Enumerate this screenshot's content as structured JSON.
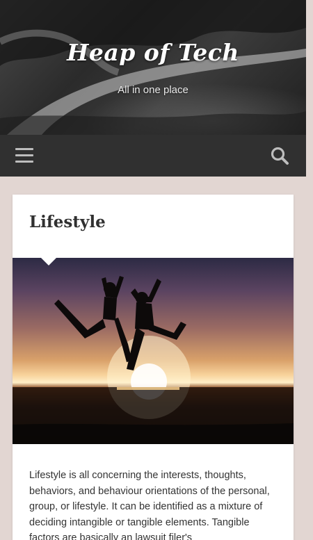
{
  "header": {
    "site_title": "Heap of Tech",
    "site_description": "All in one place"
  },
  "nav": {
    "menu_icon": "hamburger-menu-icon",
    "search_icon": "search-icon"
  },
  "post": {
    "title": "Lifestyle",
    "image_alt": "silhouettes jumping at sunset",
    "excerpt": "Lifestyle is all concerning the interests, thoughts, behaviors, and behaviour orientations of the personal, group, or lifestyle. It can be identified as a mixture of deciding intangible or tangible elements. Tangible factors are basically an lawsuit filer's"
  },
  "colors": {
    "page_bg": "#e2d6d2",
    "nav_bg": "#303030",
    "icon_gray": "#bdbdbd",
    "card_bg": "#ffffff",
    "title_color": "#303030",
    "text_color": "#333333"
  }
}
